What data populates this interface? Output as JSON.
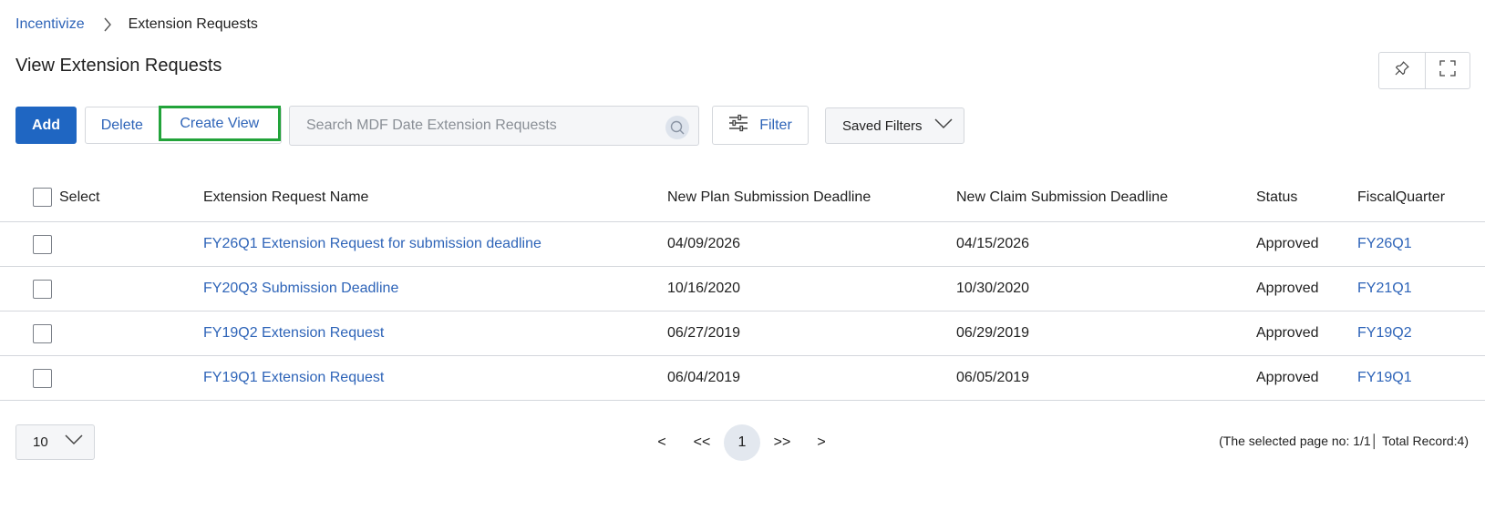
{
  "breadcrumb": {
    "root": "Incentivize",
    "current": "Extension Requests"
  },
  "page": {
    "title": "View Extension Requests"
  },
  "toolbar": {
    "add_label": "Add",
    "delete_label": "Delete",
    "create_view_label": "Create View",
    "search_placeholder": "Search MDF Date Extension Requests",
    "filter_label": "Filter",
    "saved_filters_label": "Saved Filters"
  },
  "table": {
    "headers": {
      "select": "Select",
      "name": "Extension Request Name",
      "plan": "New Plan Submission Deadline",
      "claim": "New Claim Submission Deadline",
      "status": "Status",
      "fiscal_quarter": "FiscalQuarter"
    },
    "rows": [
      {
        "name": "FY26Q1 Extension Request for submission deadline",
        "plan": "04/09/2026",
        "claim": "04/15/2026",
        "status": "Approved",
        "fiscal_quarter": "FY26Q1"
      },
      {
        "name": "FY20Q3 Submission Deadline",
        "plan": "10/16/2020",
        "claim": "10/30/2020",
        "status": "Approved",
        "fiscal_quarter": "FY21Q1"
      },
      {
        "name": "FY19Q2 Extension Request",
        "plan": "06/27/2019",
        "claim": "06/29/2019",
        "status": "Approved",
        "fiscal_quarter": "FY19Q2"
      },
      {
        "name": "FY19Q1 Extension Request",
        "plan": "06/04/2019",
        "claim": "06/05/2019",
        "status": "Approved",
        "fiscal_quarter": "FY19Q1"
      }
    ]
  },
  "pagination": {
    "page_size": "10",
    "prev": "<",
    "first": "<<",
    "current": "1",
    "last": ">>",
    "next": ">",
    "info": "(The selected page no: 1/1│ Total Record:4)"
  },
  "icons": {
    "breadcrumb_separator": "chevron-right-icon",
    "pin": "pin-icon",
    "fullscreen": "fullscreen-icon",
    "search": "search-icon",
    "filter": "sliders-icon",
    "dropdown": "chevron-down-icon"
  },
  "colors": {
    "primary": "#1f66c2",
    "link": "#2e64b8",
    "highlight_border": "#22a33a"
  }
}
